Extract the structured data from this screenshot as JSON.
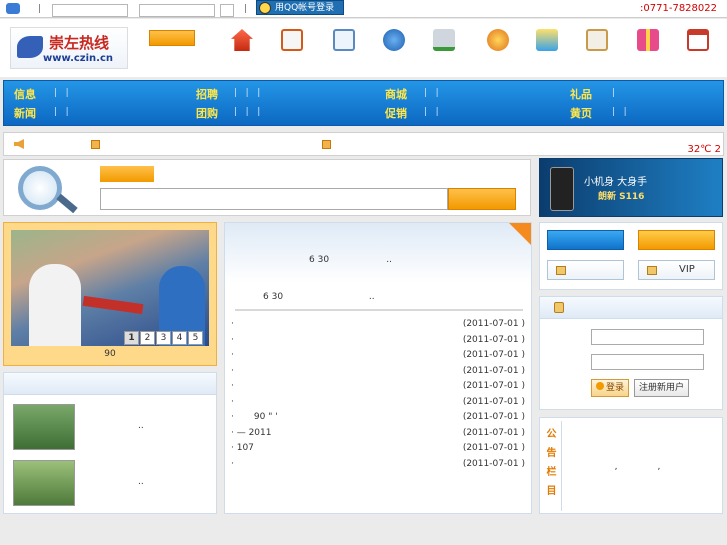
{
  "topbar": {
    "qq_login": "用QQ帐号登录",
    "phone": ":0771-7828022",
    "sep1": "|",
    "sep2": "|"
  },
  "logo": {
    "name": "崇左热线",
    "url": "www.czin.cn"
  },
  "header_icons": [
    "home-icon",
    "news-icon",
    "search-doc-icon",
    "ie-icon",
    "cart-add-icon",
    "medal-icon",
    "gift-bag-icon",
    "id-card-icon",
    "present-icon",
    "calendar-icon"
  ],
  "nav": {
    "row1": [
      "信息",
      "招聘",
      "商城",
      "礼品"
    ],
    "row2": [
      "新闻",
      "团购",
      "促销",
      "黄页"
    ]
  },
  "ticker": {
    "weather": "32℃ 2"
  },
  "ad": {
    "line1": "小机身 大身手",
    "line2": "朗新 S116"
  },
  "photo": {
    "pages": [
      "1",
      "2",
      "3",
      "4",
      "5"
    ],
    "caption": "90"
  },
  "news": {
    "headline": "6 30                    ..",
    "sub": "6 30                              ..",
    "rows": [
      {
        "title": "·",
        "date": "(2011-07-01 )"
      },
      {
        "title": "·",
        "date": "(2011-07-01 )"
      },
      {
        "title": "·",
        "date": "(2011-07-01 )"
      },
      {
        "title": "·",
        "date": "(2011-07-01 )"
      },
      {
        "title": "·",
        "date": "(2011-07-01 )"
      },
      {
        "title": "·",
        "date": "(2011-07-01 )"
      },
      {
        "title": "·       90 \" '",
        "date": "(2011-07-01 )"
      },
      {
        "title": "· — 2011",
        "date": "(2011-07-01 )"
      },
      {
        "title": "· 107",
        "date": "(2011-07-01 )"
      },
      {
        "title": "·",
        "date": "(2011-07-01 )"
      }
    ]
  },
  "right_panel": {
    "vip_label": "VIP"
  },
  "login": {
    "login_btn": "登录",
    "register_btn": "注册新用户"
  },
  "notice": {
    "label_chars": [
      "公",
      "告",
      "栏",
      "目"
    ],
    "text": "                 ,              ,"
  }
}
